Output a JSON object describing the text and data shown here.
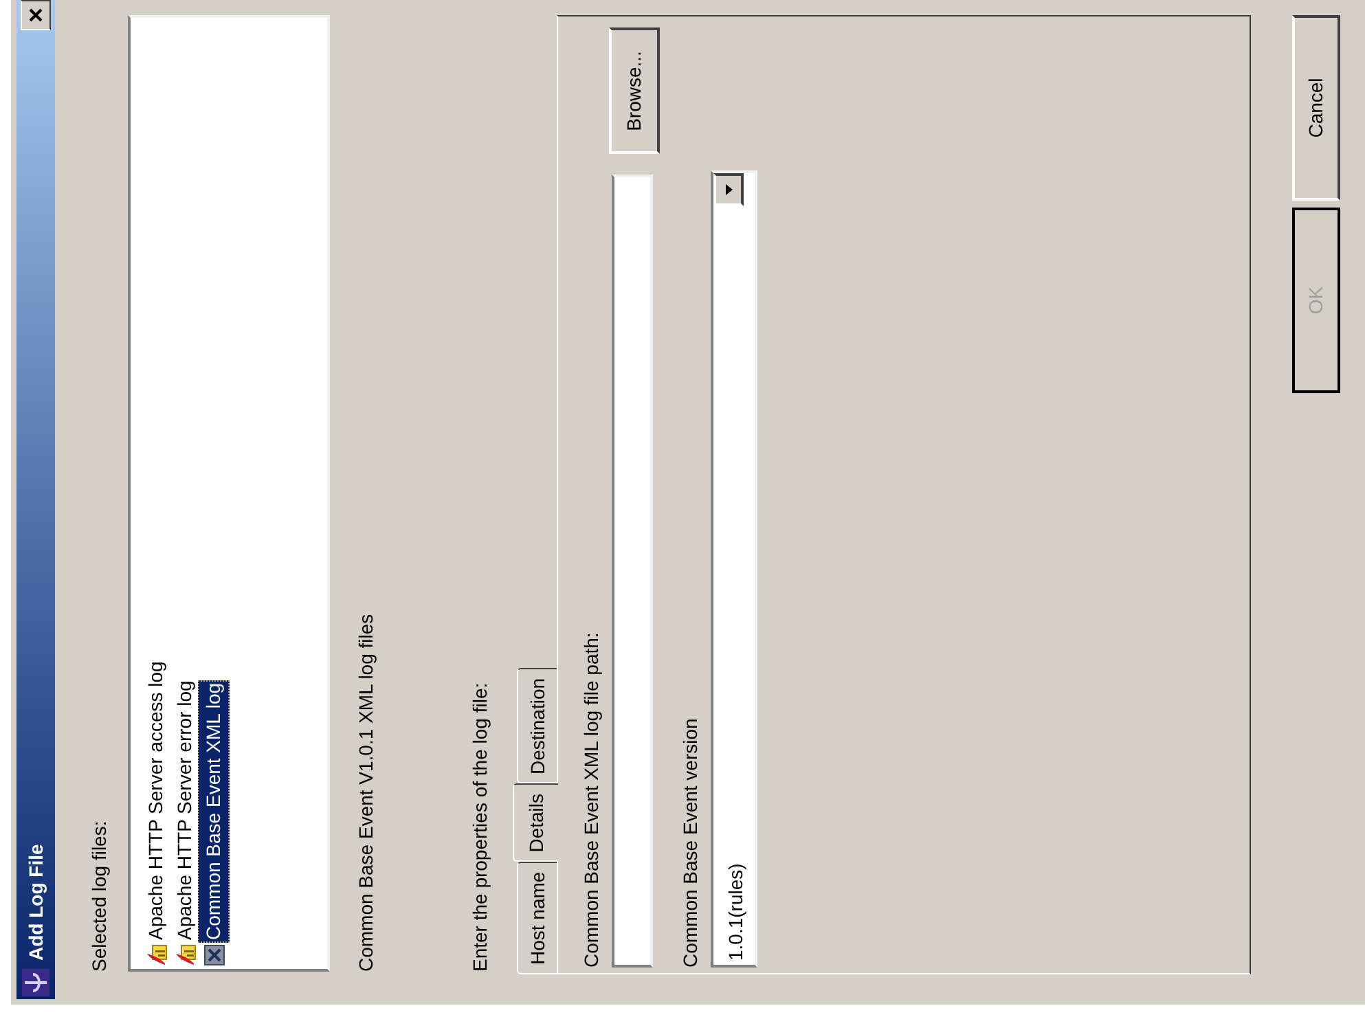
{
  "window": {
    "title": "Add Log File"
  },
  "selected_log_files": {
    "label": "Selected log files:",
    "items": [
      {
        "label": "Apache HTTP Server access log",
        "kind": "apache",
        "selected": false
      },
      {
        "label": "Apache HTTP Server error log",
        "kind": "apache",
        "selected": false
      },
      {
        "label": "Common Base Event XML log",
        "kind": "xml",
        "selected": true
      }
    ]
  },
  "description": "Common Base Event V1.0.1 XML log files",
  "properties_label": "Enter the properties of the log file:",
  "tabs": [
    {
      "label": "Host name",
      "selected": false
    },
    {
      "label": "Details",
      "selected": true
    },
    {
      "label": "Destination",
      "selected": false
    }
  ],
  "details": {
    "path_label": "Common Base Event XML log file path:",
    "browse_button": "Browse...",
    "version_label": "Common Base Event version",
    "version_value": "1.0.1(rules)"
  },
  "buttons": [
    {
      "label": "OK",
      "disabled": true
    },
    {
      "label": "Cancel",
      "disabled": false
    }
  ]
}
